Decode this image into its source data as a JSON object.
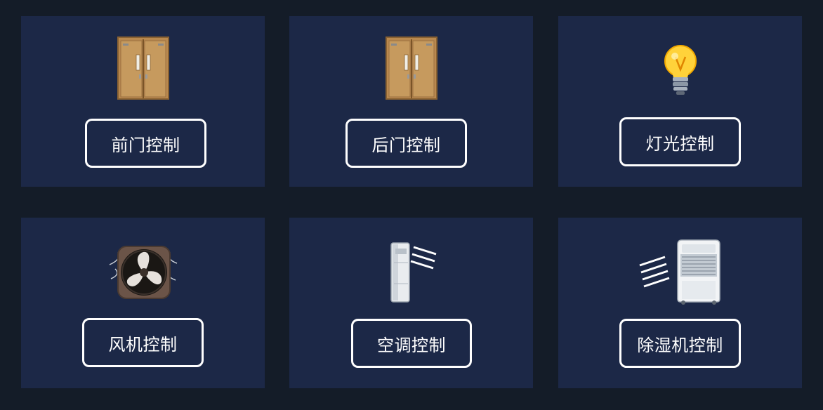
{
  "colors": {
    "background": "#141c28",
    "card": "#1c2847",
    "button_border": "#ffffff",
    "button_text": "#ffffff"
  },
  "cards": [
    {
      "label": "前门控制",
      "icon": "door-icon"
    },
    {
      "label": "后门控制",
      "icon": "door-icon"
    },
    {
      "label": "灯光控制",
      "icon": "light-bulb-icon"
    },
    {
      "label": "风机控制",
      "icon": "fan-icon"
    },
    {
      "label": "空调控制",
      "icon": "air-conditioner-icon"
    },
    {
      "label": "除湿机控制",
      "icon": "dehumidifier-icon"
    }
  ]
}
